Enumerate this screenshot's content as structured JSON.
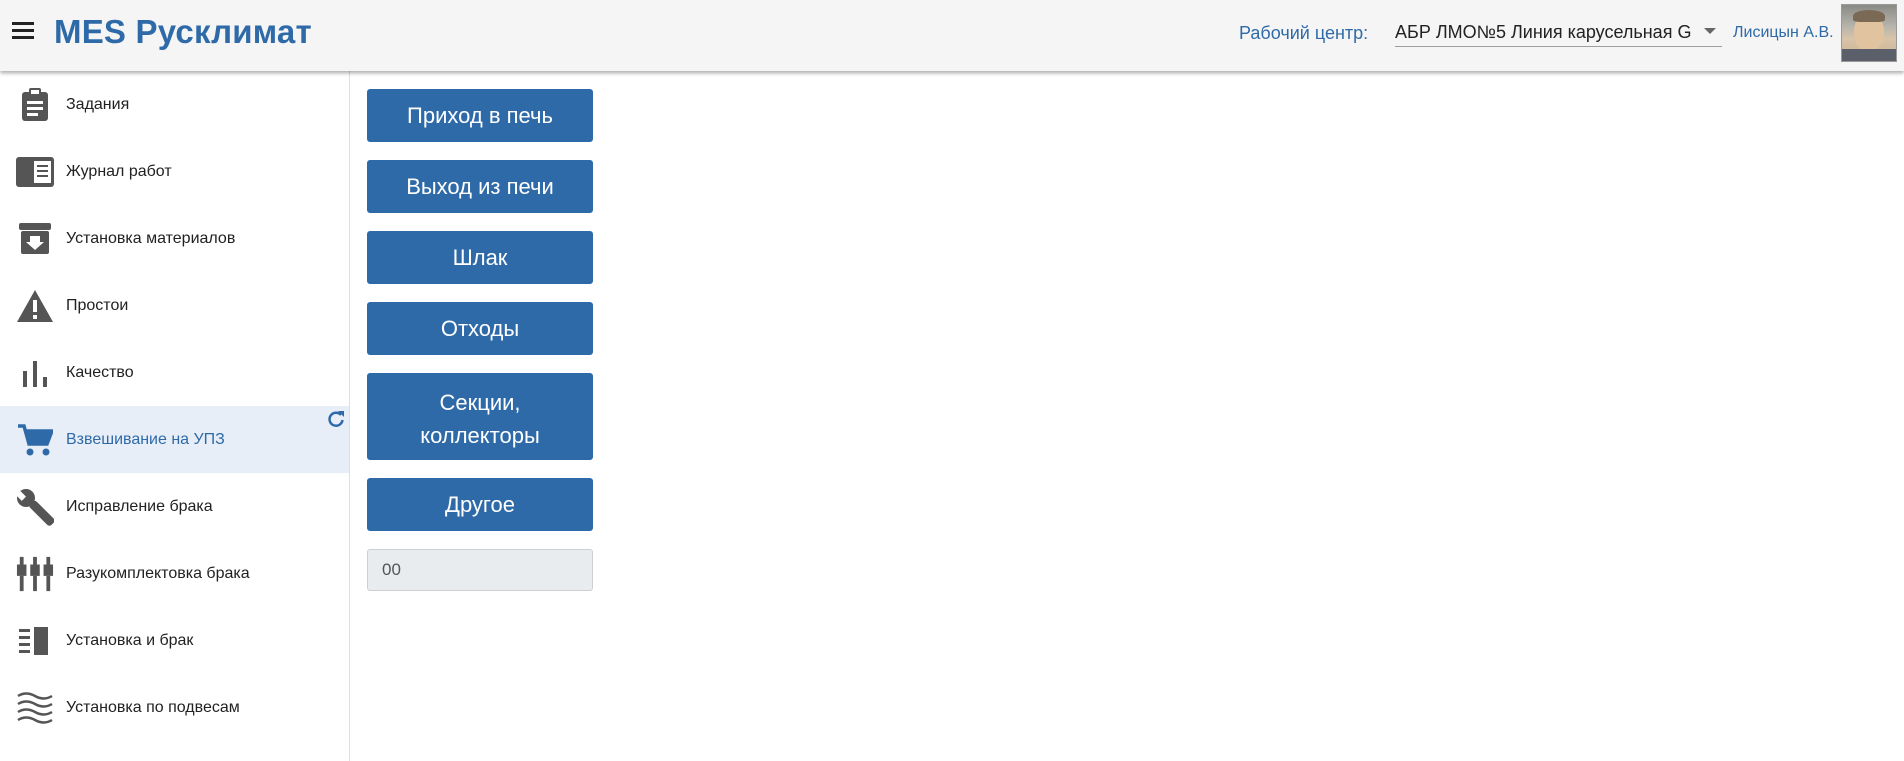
{
  "header": {
    "title": "MES Русклимат",
    "work_center_label": "Рабочий центр:",
    "work_center_value": "АБР ЛМО№5 Линия карусельная G",
    "user_name": "Лисицын А.В.",
    "accent_color": "#2f6aa8"
  },
  "sidebar": {
    "items": [
      {
        "label": "Задания",
        "icon": "clipboard-icon"
      },
      {
        "label": "Журнал работ",
        "icon": "journal-icon"
      },
      {
        "label": "Установка материалов",
        "icon": "archive-download-icon"
      },
      {
        "label": "Простои",
        "icon": "warning-icon"
      },
      {
        "label": "Качество",
        "icon": "bar-chart-icon"
      },
      {
        "label": "Взвешивание на УПЗ",
        "icon": "cart-icon",
        "active": true
      },
      {
        "label": "Исправление брака",
        "icon": "wrench-icon"
      },
      {
        "label": "Разукомплектовка брака",
        "icon": "plugs-icon"
      },
      {
        "label": "Установка и брак",
        "icon": "list-block-icon"
      },
      {
        "label": "Установка по подвесам",
        "icon": "waves-icon"
      }
    ]
  },
  "main": {
    "buttons": [
      "Приход в печь",
      "Выход из печи",
      "Шлак",
      "Отходы",
      "Секции,\nколлекторы",
      "Другое"
    ],
    "input_value": "00"
  }
}
